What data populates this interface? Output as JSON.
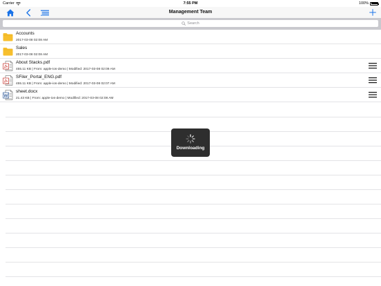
{
  "status": {
    "carrier": "Carrier",
    "time": "7:55 PM",
    "battery": "100%",
    "battery_level_percent": 100
  },
  "nav": {
    "title": "Management Team",
    "home_icon": "home-icon",
    "back_icon": "chevron-left-icon",
    "list_icon": "list-view-icon",
    "add_icon": "plus-icon"
  },
  "search": {
    "placeholder": "Search"
  },
  "items": [
    {
      "type": "folder",
      "icon": "folder-icon",
      "title": "Accounts",
      "subtitle": "2017-03-08 02:08 AM",
      "menu": false
    },
    {
      "type": "folder",
      "icon": "folder-icon",
      "title": "Sales",
      "subtitle": "2017-03-08 02:08 AM",
      "menu": false
    },
    {
      "type": "pdf",
      "icon": "pdf-file-icon",
      "title": "About Stacks.pdf",
      "subtitle": "455.11 KB | From: apple-ios-demo | Modified: 2017-03-08 02:09 AM",
      "menu": true
    },
    {
      "type": "pdf",
      "icon": "pdf-file-icon",
      "title": "SFiler_Portal_ENG.pdf",
      "subtitle": "455.11 KB | From: apple-ios-demo | Modified: 2017-03-08 02:07 AM",
      "menu": true
    },
    {
      "type": "docx",
      "icon": "word-file-icon",
      "title": "sheet.docx",
      "subtitle": "21.43 KB | From: apple-ios-demo | Modified: 2017-03-08 02:08 AM",
      "menu": true
    }
  ],
  "hud": {
    "label": "Downloading",
    "icon": "spinner-icon"
  },
  "colors": {
    "accent": "#1a73e8",
    "folder": "#f7bf2d",
    "pdf": "#c8322c",
    "word": "#2b5797",
    "hud_bg": "#2e2e2e",
    "search_bar_bg": "#c9c9ce"
  }
}
